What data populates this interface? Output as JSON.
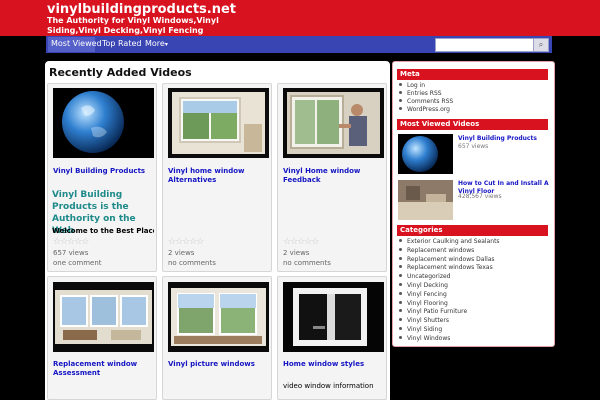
{
  "header": {
    "site_title": "vinylbuildingproducts.net",
    "tagline": "The Authority for Vinyl Windows,Vinyl Siding,Vinyl Decking,Vinyl Fencing"
  },
  "nav": {
    "items": [
      "Most Viewed",
      "Top Rated",
      "More"
    ],
    "search_placeholder": ""
  },
  "main": {
    "title": "Recently Added Videos",
    "videos": [
      {
        "title": "Vinyl Building Products",
        "views": "657 views",
        "comments": "one comment",
        "rating": 0
      },
      {
        "title": "Vinyl home window Alternatives",
        "views": "2 views",
        "comments": "no comments",
        "rating": 0
      },
      {
        "title": "Vinyl Home window Feedback",
        "views": "2 views",
        "comments": "no comments",
        "rating": 0
      },
      {
        "title": "Replacement window Assessment"
      },
      {
        "title": "Vinyl picture windows"
      },
      {
        "title": "Home window styles",
        "excerpt": "video window information"
      }
    ],
    "excerpt_heading": "Vinyl Building Products is the Authority on the Web",
    "excerpt_text": "Welcome to the Best Place on",
    "stars": "☆☆☆☆☆"
  },
  "sidebar": {
    "meta": {
      "title": "Meta",
      "items": [
        "Log in",
        "Entries RSS",
        "Comments RSS",
        "WordPress.org"
      ]
    },
    "most_viewed": {
      "title": "Most Viewed Videos",
      "items": [
        {
          "title": "Vinyl Building Products",
          "views": "657 views"
        },
        {
          "title": "How to Cut In and Install A Vinyl Floor",
          "views": "428,567 views"
        }
      ]
    },
    "categories": {
      "title": "Categories",
      "items": [
        "Exterior Caulking and Sealants",
        "Replacement windows",
        "Replacement windows Dallas",
        "Replacement windows Texas",
        "Uncategorized",
        "Vinyl Decking",
        "Vinyl Fencing",
        "Vinyl Flooring",
        "Vinyl Patio Furniture",
        "Vinyl Shutters",
        "Vinyl Siding",
        "Vinyl Windows"
      ]
    }
  },
  "colors": {
    "brand_red": "#d9121f",
    "nav_blue": "#3a45b4",
    "link_blue": "#1515c4",
    "excerpt_teal": "#1f8a8a"
  },
  "icons": {
    "search": "search-icon",
    "more": "chevron-down-icon"
  }
}
